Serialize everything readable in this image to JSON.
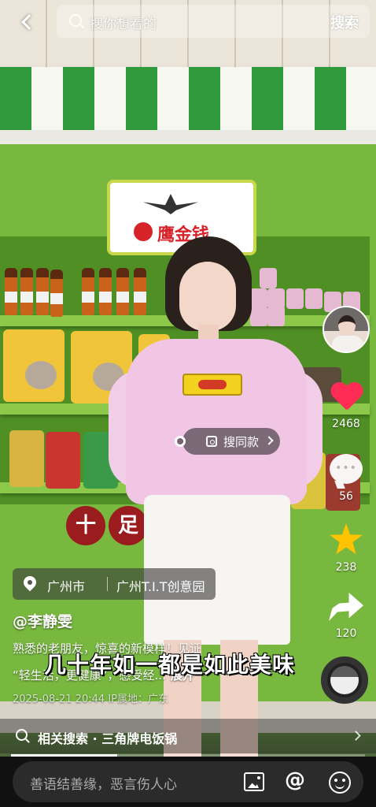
{
  "search": {
    "placeholder": "搜你想看的",
    "button_label": "搜索"
  },
  "video": {
    "product_chip_label": "搜同款",
    "subtitle_text": "几十年如一都是如此美味",
    "brand_sign_text": "鹰金钱",
    "banner_chars": [
      "十",
      "足"
    ]
  },
  "actions": {
    "likes": "2468",
    "comments": "56",
    "favorites": "238",
    "shares": "120"
  },
  "location": {
    "city": "广州市",
    "place": "广州T.I.T创意园"
  },
  "post": {
    "author": "@李静雯",
    "description_line1": "熟悉的老朋友，惊喜的新模样！见证",
    "description_line2": "“轻生活，更健康”，感受经...",
    "expand_label": "展开",
    "meta": "2025-08-21 20:44  IP属地：广东"
  },
  "related_search": {
    "label": "相关搜索 · 三角牌电饭锅"
  },
  "playback": {
    "progress_fraction": 0.3
  },
  "comment_bar": {
    "placeholder": "善语结善缘，恶言伤人心"
  },
  "icons": {
    "back": "back-arrow-icon",
    "search": "search-icon",
    "like": "heart-icon",
    "comment": "comment-icon",
    "favorite": "star-icon",
    "share": "share-icon",
    "location": "location-pin-icon",
    "image": "image-icon",
    "mention": "at-icon",
    "emoji": "emoji-icon"
  },
  "colors": {
    "like_red": "#fe2c55",
    "favorite_yellow": "#ffc300"
  }
}
